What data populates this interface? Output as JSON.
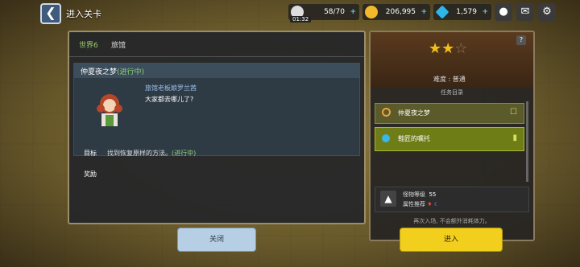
{
  "header": {
    "back_icon": "back-arrow-icon",
    "title": "进入关卡"
  },
  "resources": [
    {
      "icon": "coffee-icon",
      "value": "58/70",
      "color": "#e8e8e8"
    },
    {
      "icon": "gold-coin-icon",
      "value": "206,995",
      "color": "#f2b92a"
    },
    {
      "icon": "gem-icon",
      "value": "1,579",
      "color": "#2fb6e8"
    }
  ],
  "timer": "01:32",
  "top_buttons": [
    "chat-icon",
    "mail-icon",
    "settings-gear-icon"
  ],
  "left_panel": {
    "world": "世界6",
    "location": "旅馆",
    "quest": {
      "title": "仲夏夜之梦",
      "status": "(进行中)"
    },
    "npc": {
      "name": "旅馆老板娘罗兰茜",
      "line": "大家都去哪儿了?"
    },
    "goal_label": "目标",
    "goal_text": "找到恢复原样的方法。",
    "goal_status": "(进行中)",
    "reward_label": "奖励",
    "close_label": "关闭"
  },
  "right_panel": {
    "difficulty_stars": 2,
    "difficulty_stars_max": 3,
    "difficulty_label": "难度 : 普通",
    "task_section": "任务目录",
    "tasks": [
      {
        "name": "仲夏夜之梦",
        "icon": "orange-ring-icon",
        "color": "#f0a040"
      },
      {
        "name": "鞋匠的嘱托",
        "icon": "blue-circle-icon",
        "color": "#3ab6e8"
      }
    ],
    "monster_level_label": "怪物等级",
    "monster_level": "55",
    "attr_label": "属性推荐",
    "attr_icons": [
      "fire-icon",
      "dark-icon"
    ],
    "note": "再次入场, 不会额外消耗体力。",
    "enter_label": "进入"
  }
}
